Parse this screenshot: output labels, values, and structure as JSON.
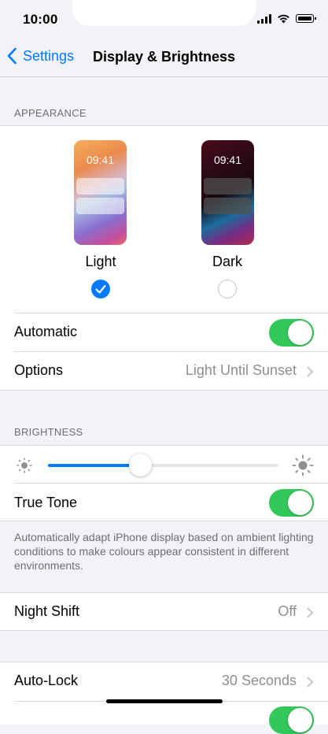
{
  "status_bar": {
    "time": "10:00"
  },
  "nav": {
    "back_label": "Settings",
    "title": "Display & Brightness"
  },
  "appearance": {
    "header": "APPEARANCE",
    "preview_time": "09:41",
    "options": [
      {
        "label": "Light",
        "selected": true
      },
      {
        "label": "Dark",
        "selected": false
      }
    ],
    "automatic": {
      "label": "Automatic",
      "on": true
    },
    "options_row": {
      "label": "Options",
      "value": "Light Until Sunset"
    }
  },
  "brightness": {
    "header": "BRIGHTNESS",
    "level": 0.4,
    "true_tone": {
      "label": "True Tone",
      "on": true
    },
    "footnote": "Automatically adapt iPhone display based on ambient lighting conditions to make colours appear consistent in different environments."
  },
  "night_shift": {
    "label": "Night Shift",
    "value": "Off"
  },
  "auto_lock": {
    "label": "Auto-Lock",
    "value": "30 Seconds"
  },
  "colors": {
    "accent": "#007aff",
    "toggle_on": "#34c759",
    "secondary_text": "#8e8e93"
  }
}
